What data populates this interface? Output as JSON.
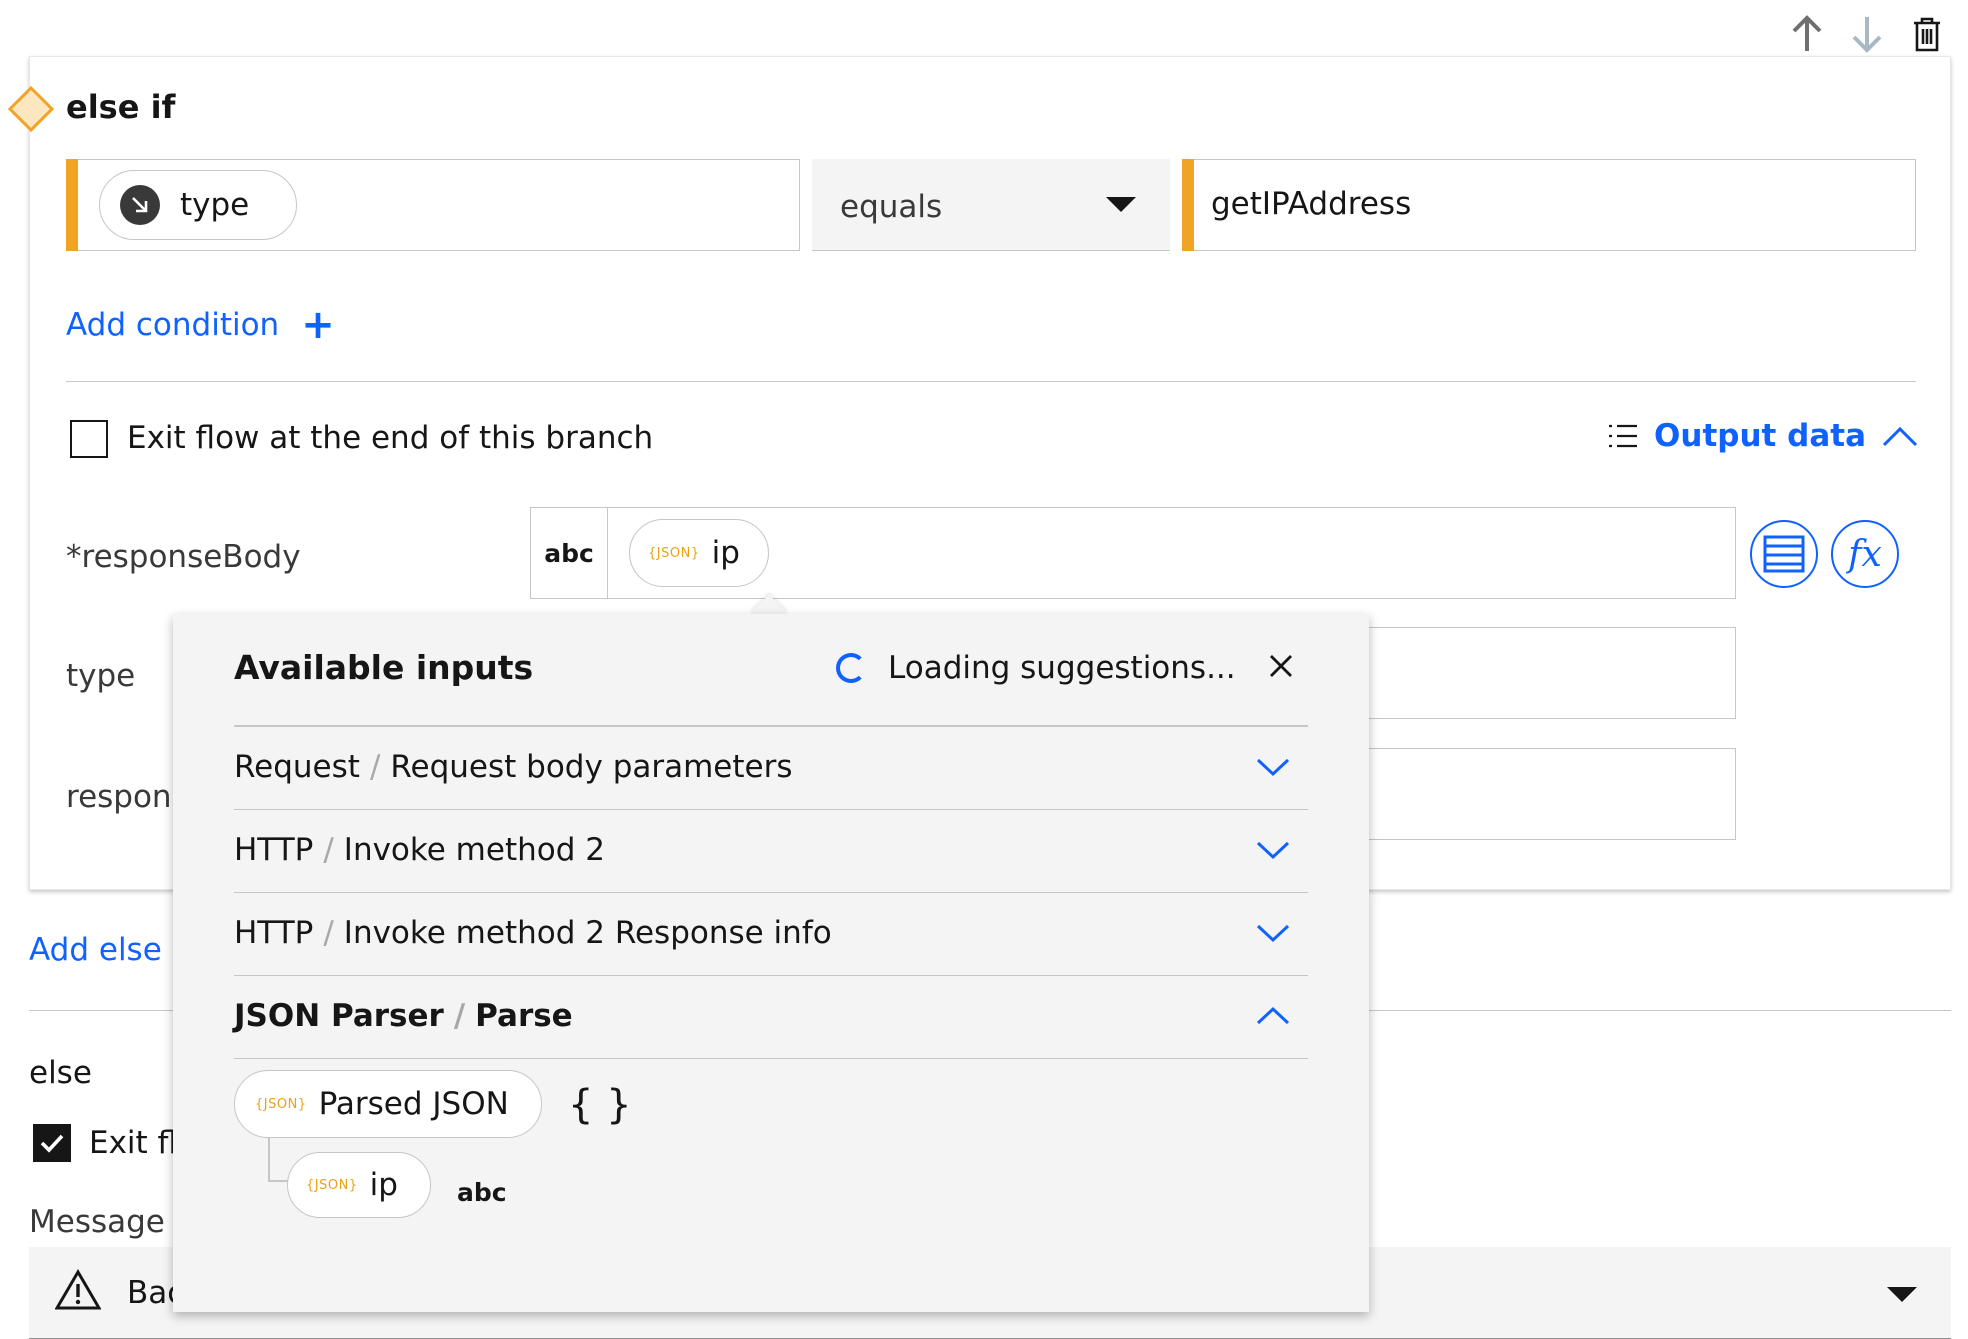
{
  "branch": {
    "title": "else if",
    "condition": {
      "left_variable": "type",
      "operator": "equals",
      "right_value": "getIPAddress"
    },
    "add_condition_label": "Add condition",
    "exit_flow_label": "Exit flow at the end of this branch",
    "exit_flow_checked": false,
    "output_data_label": "Output data",
    "fields": [
      {
        "label": "*responseBody",
        "type_badge": "abc",
        "token_tag": "{JSON}",
        "token_label": "ip"
      },
      {
        "label": "type"
      },
      {
        "label": "respons"
      }
    ]
  },
  "add_else_if_label": "Add else i",
  "else_section": {
    "title": "else",
    "exit_flow_label": "Exit fl",
    "exit_flow_checked": true,
    "message_label": "Message t",
    "select_text": "Bac"
  },
  "popover": {
    "title": "Available inputs",
    "loading_text": "Loading suggestions...",
    "groups": [
      {
        "source": "Request",
        "name": "Request body parameters",
        "expanded": false
      },
      {
        "source": "HTTP",
        "name": "Invoke method 2",
        "expanded": false
      },
      {
        "source": "HTTP",
        "name": "Invoke method 2 Response info",
        "expanded": false
      },
      {
        "source": "JSON Parser",
        "name": "Parse",
        "expanded": true
      }
    ],
    "separator": "/",
    "tree": {
      "root_tag": "{JSON}",
      "root_label": "Parsed JSON",
      "root_type": "{ }",
      "child_tag": "{JSON}",
      "child_label": "ip",
      "child_type": "abc"
    }
  },
  "colors": {
    "accent_orange": "#f1a325",
    "link_blue": "#0f62fe",
    "json_tag": "#e8a317"
  }
}
